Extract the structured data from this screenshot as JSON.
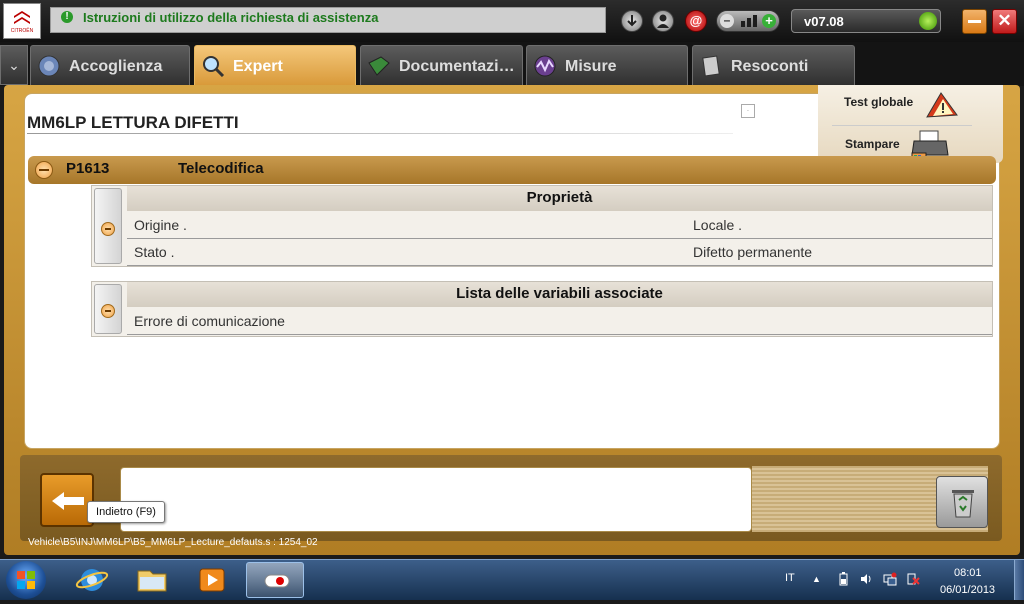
{
  "titlebar": {
    "logo_text": "CITROËN",
    "assist_text": "Istruzioni di utilizzo della richiesta di assistenza",
    "version": "v07.08"
  },
  "tabs": [
    {
      "label": "Accoglienza",
      "icon": "welcome-icon"
    },
    {
      "label": "Expert",
      "icon": "magnifier-icon",
      "active": true
    },
    {
      "label": "Documentazi…",
      "icon": "book-icon"
    },
    {
      "label": "Misure",
      "icon": "oscilloscope-icon"
    },
    {
      "label": "Resoconti",
      "icon": "report-icon"
    }
  ],
  "page": {
    "title": "MM6LP  LETTURA DIFETTI"
  },
  "side_actions": {
    "global_test": "Test globale",
    "print": "Stampare"
  },
  "fault": {
    "code": "P1613",
    "description": "Telecodifica"
  },
  "properties": {
    "header": "Proprietà",
    "rows": [
      {
        "left": "Origine .",
        "right": "Locale ."
      },
      {
        "left": "Stato .",
        "right": "Difetto permanente"
      }
    ]
  },
  "variables": {
    "header": "Lista delle variabili associate",
    "rows": [
      {
        "left": "Errore di comunicazione"
      }
    ]
  },
  "bottom": {
    "back_tooltip": "Indietro (F9)",
    "path": "Vehicle\\B5\\INJ\\MM6LP\\B5_MM6LP_Lecture_defauts.s : 1254_02"
  },
  "taskbar": {
    "language": "IT",
    "time": "08:01",
    "date": "06/01/2013"
  },
  "colors": {
    "accent": "#d99a3a",
    "frame": "#b9872e",
    "assist_text": "#1d7a1d"
  }
}
